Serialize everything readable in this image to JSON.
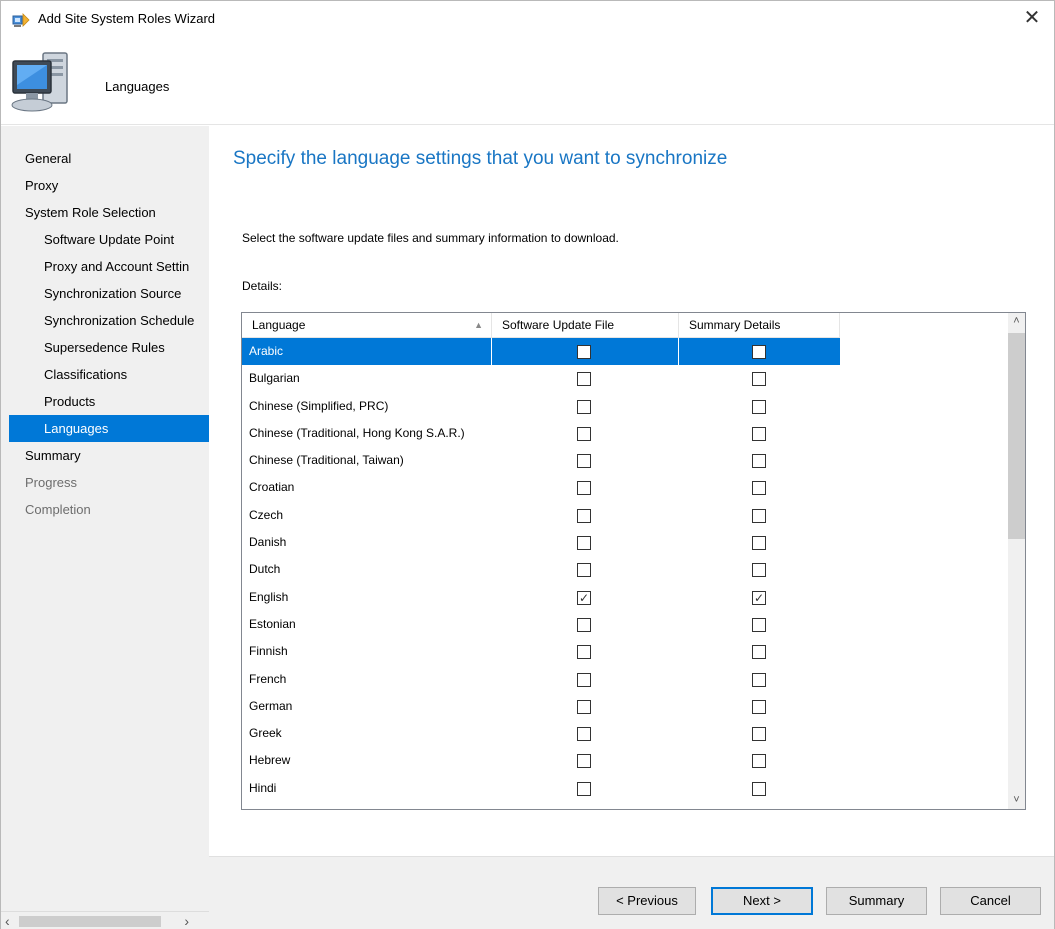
{
  "window": {
    "title": "Add Site System Roles Wizard",
    "close_glyph": "✕"
  },
  "header": {
    "page_heading": "Languages",
    "icon": "computer-icon"
  },
  "nav": {
    "items": [
      {
        "label": "General",
        "level": 0,
        "state": "normal"
      },
      {
        "label": "Proxy",
        "level": 0,
        "state": "normal"
      },
      {
        "label": "System Role Selection",
        "level": 0,
        "state": "normal"
      },
      {
        "label": "Software Update Point",
        "level": 1,
        "state": "normal"
      },
      {
        "label": "Proxy and Account Settin",
        "level": 1,
        "state": "normal"
      },
      {
        "label": "Synchronization Source",
        "level": 1,
        "state": "normal"
      },
      {
        "label": "Synchronization Schedule",
        "level": 1,
        "state": "normal"
      },
      {
        "label": "Supersedence Rules",
        "level": 1,
        "state": "normal"
      },
      {
        "label": "Classifications",
        "level": 1,
        "state": "normal"
      },
      {
        "label": "Products",
        "level": 1,
        "state": "normal"
      },
      {
        "label": "Languages",
        "level": 1,
        "state": "selected"
      },
      {
        "label": "Summary",
        "level": 0,
        "state": "normal"
      },
      {
        "label": "Progress",
        "level": 0,
        "state": "disabled"
      },
      {
        "label": "Completion",
        "level": 0,
        "state": "disabled"
      }
    ]
  },
  "main": {
    "heading": "Specify the language settings that you want to synchronize",
    "instruction": "Select the software update files and summary information to download.",
    "details_label": "Details:",
    "grid": {
      "columns": [
        "Language",
        "Software Update File",
        "Summary Details"
      ],
      "rows": [
        {
          "language": "Arabic",
          "update_file": false,
          "summary": false,
          "selected": true
        },
        {
          "language": "Bulgarian",
          "update_file": false,
          "summary": false
        },
        {
          "language": "Chinese (Simplified, PRC)",
          "update_file": false,
          "summary": false
        },
        {
          "language": "Chinese (Traditional, Hong Kong S.A.R.)",
          "update_file": false,
          "summary": false
        },
        {
          "language": "Chinese (Traditional, Taiwan)",
          "update_file": false,
          "summary": false
        },
        {
          "language": "Croatian",
          "update_file": false,
          "summary": false
        },
        {
          "language": "Czech",
          "update_file": false,
          "summary": false
        },
        {
          "language": "Danish",
          "update_file": false,
          "summary": false
        },
        {
          "language": "Dutch",
          "update_file": false,
          "summary": false
        },
        {
          "language": "English",
          "update_file": true,
          "summary": true
        },
        {
          "language": "Estonian",
          "update_file": false,
          "summary": false
        },
        {
          "language": "Finnish",
          "update_file": false,
          "summary": false
        },
        {
          "language": "French",
          "update_file": false,
          "summary": false
        },
        {
          "language": "German",
          "update_file": false,
          "summary": false
        },
        {
          "language": "Greek",
          "update_file": false,
          "summary": false
        },
        {
          "language": "Hebrew",
          "update_file": false,
          "summary": false
        },
        {
          "language": "Hindi",
          "update_file": false,
          "summary": false
        }
      ]
    }
  },
  "footer": {
    "previous_label": "< Previous",
    "next_label": "Next >",
    "summary_label": "Summary",
    "cancel_label": "Cancel"
  },
  "colors": {
    "accent": "#0078d7",
    "heading": "#1976c4",
    "nav_bg": "#f0f0f0"
  }
}
